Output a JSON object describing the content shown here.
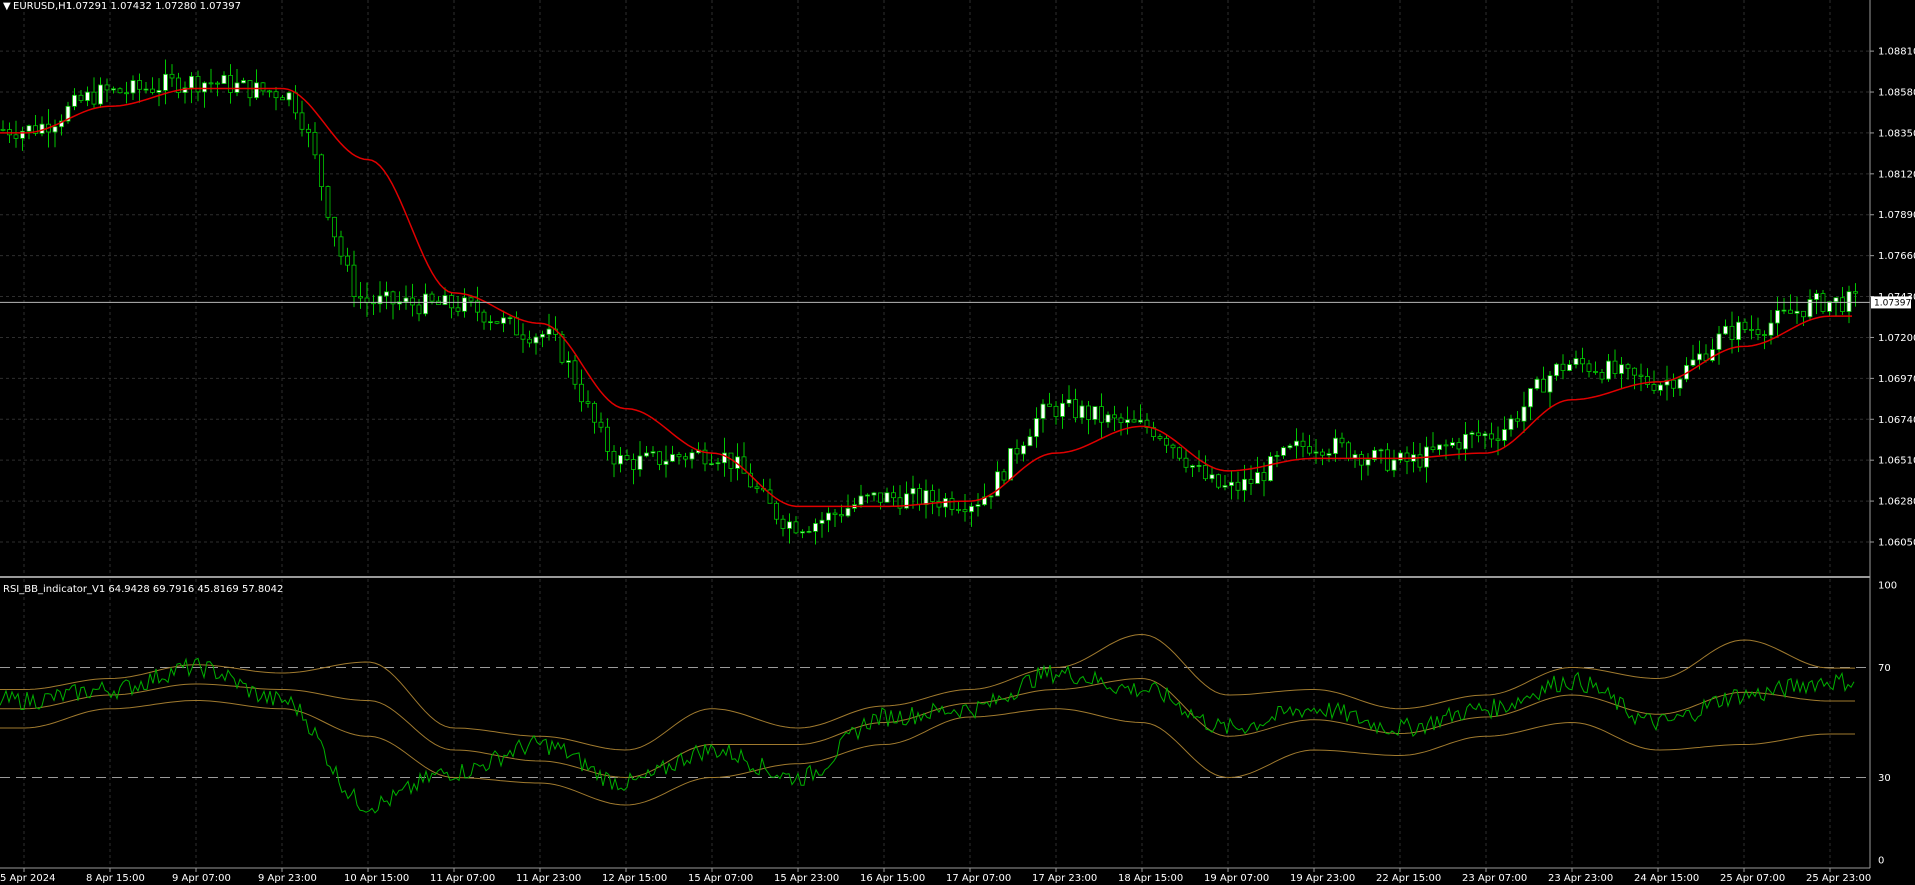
{
  "main_chart": {
    "title_marker": "▼",
    "symbol": "EURUSD,H1",
    "ohlc": "1.07291 1.07432 1.07280 1.07397",
    "price_labels": [
      "1.08810",
      "1.08580",
      "1.08350",
      "1.08120",
      "1.07890",
      "1.07660",
      "1.07430",
      "1.07200",
      "1.06970",
      "1.06740",
      "1.06510",
      "1.06280",
      "1.06050"
    ],
    "current_price": "1.07397"
  },
  "indicator": {
    "title": "RSI_BB_indicator_V1 64.9428 69.7916 45.8169 57.8042",
    "levels": [
      "100",
      "70",
      "30",
      "0"
    ]
  },
  "time_labels": [
    "5 Apr 2024",
    "8 Apr 15:00",
    "9 Apr 07:00",
    "9 Apr 23:00",
    "10 Apr 15:00",
    "11 Apr 07:00",
    "11 Apr 23:00",
    "12 Apr 15:00",
    "15 Apr 07:00",
    "15 Apr 23:00",
    "16 Apr 15:00",
    "17 Apr 07:00",
    "17 Apr 23:00",
    "18 Apr 15:00",
    "19 Apr 07:00",
    "19 Apr 23:00",
    "22 Apr 15:00",
    "23 Apr 07:00",
    "23 Apr 23:00",
    "24 Apr 15:00",
    "25 Apr 07:00",
    "25 Apr 23:00"
  ],
  "colors": {
    "background": "#000000",
    "grid": "#2e2e2e",
    "axis": "#9a9a9a",
    "bull_candle": "#ffffff",
    "bear_candle": "#000000",
    "wick": "#00c800",
    "ma_line": "#e00000",
    "rsi_line": "#00b000",
    "band_line": "#a07a2e",
    "level_line": "#9a9a9a"
  },
  "chart_data": [
    {
      "type": "candlestick",
      "title": "EURUSD,H1",
      "ylim": [
        1.0596,
        1.0894
      ],
      "x": [
        "5 Apr 2024",
        "8 Apr 15:00",
        "9 Apr 07:00",
        "9 Apr 23:00",
        "10 Apr 15:00",
        "11 Apr 07:00",
        "11 Apr 23:00",
        "12 Apr 15:00",
        "15 Apr 07:00",
        "15 Apr 23:00",
        "16 Apr 15:00",
        "17 Apr 07:00",
        "17 Apr 23:00",
        "18 Apr 15:00",
        "19 Apr 07:00",
        "19 Apr 23:00",
        "22 Apr 15:00",
        "23 Apr 07:00",
        "23 Apr 23:00",
        "24 Apr 15:00",
        "25 Apr 07:00",
        "25 Apr 23:00"
      ],
      "close": [
        1.0837,
        1.0858,
        1.0864,
        1.0858,
        1.074,
        1.0738,
        1.0722,
        1.065,
        1.0655,
        1.0615,
        1.063,
        1.0628,
        1.068,
        1.067,
        1.0635,
        1.066,
        1.065,
        1.0665,
        1.0705,
        1.0695,
        1.0725,
        1.074
      ],
      "series": [
        {
          "name": "",
          "values": [
            1.0835,
            1.085,
            1.086,
            1.086,
            1.082,
            1.0745,
            1.0728,
            1.068,
            1.0655,
            1.0625,
            1.0625,
            1.0628,
            1.0655,
            1.067,
            1.0645,
            1.0652,
            1.0652,
            1.0655,
            1.0685,
            1.0695,
            1.0715,
            1.0732
          ]
        }
      ]
    },
    {
      "type": "line",
      "title": "RSI_BB_indicator_V1",
      "ylim": [
        0,
        100
      ],
      "x": [
        "5 Apr 2024",
        "8 Apr 15:00",
        "9 Apr 07:00",
        "9 Apr 23:00",
        "10 Apr 15:00",
        "11 Apr 07:00",
        "11 Apr 23:00",
        "12 Apr 15:00",
        "15 Apr 07:00",
        "15 Apr 23:00",
        "16 Apr 15:00",
        "17 Apr 07:00",
        "17 Apr 23:00",
        "18 Apr 15:00",
        "19 Apr 07:00",
        "19 Apr 23:00",
        "22 Apr 15:00",
        "23 Apr 07:00",
        "23 Apr 23:00",
        "24 Apr 15:00",
        "25 Apr 07:00",
        "25 Apr 23:00"
      ],
      "levels": [
        70,
        30
      ],
      "series": [
        {
          "name": "",
          "values": [
            58,
            62,
            70,
            58,
            20,
            32,
            42,
            28,
            40,
            30,
            52,
            55,
            68,
            62,
            48,
            55,
            48,
            55,
            65,
            50,
            60,
            64.94
          ]
        },
        {
          "name": "",
          "values": [
            62,
            66,
            71,
            68,
            72,
            48,
            45,
            40,
            55,
            48,
            56,
            62,
            70,
            82,
            60,
            62,
            55,
            60,
            70,
            66,
            80,
            69.79
          ]
        },
        {
          "name": "",
          "values": [
            48,
            55,
            58,
            55,
            45,
            30,
            28,
            20,
            30,
            35,
            42,
            52,
            55,
            50,
            30,
            40,
            38,
            45,
            50,
            40,
            42,
            45.82
          ]
        },
        {
          "name": "",
          "values": [
            55,
            60,
            64,
            62,
            58,
            40,
            36,
            30,
            42,
            42,
            50,
            57,
            62,
            66,
            45,
            51,
            46,
            52,
            60,
            53,
            61,
            57.8
          ]
        }
      ]
    }
  ]
}
